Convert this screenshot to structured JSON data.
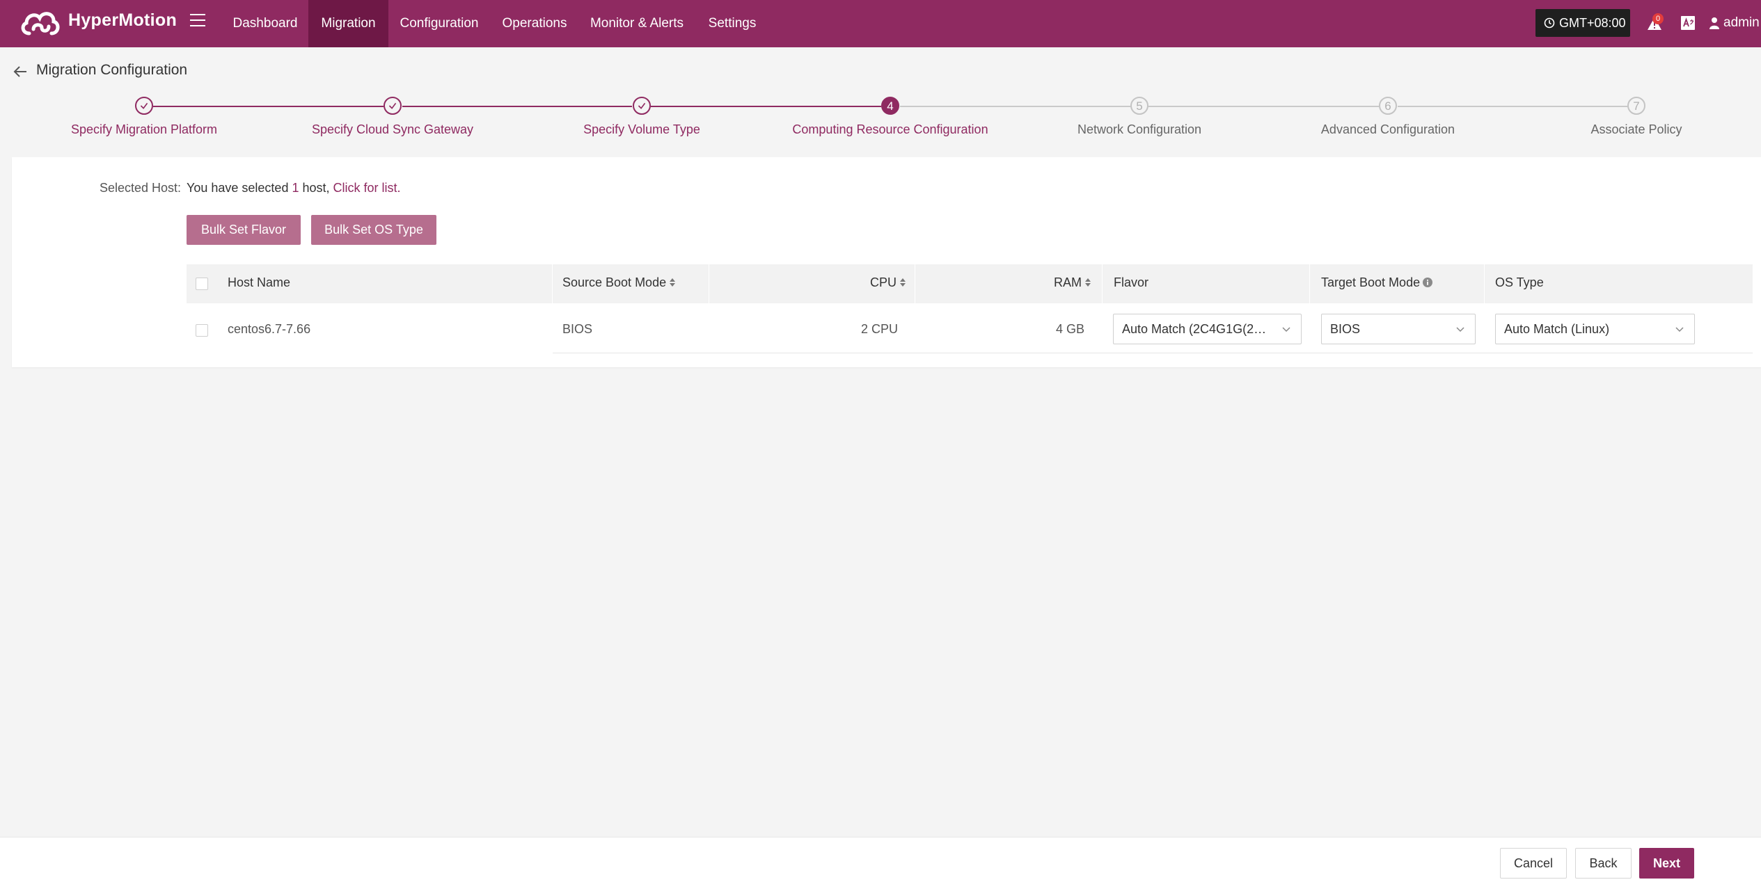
{
  "app": {
    "name": "HyperMotion"
  },
  "nav": {
    "items": [
      "Dashboard",
      "Migration",
      "Configuration",
      "Operations",
      "Monitor & Alerts",
      "Settings"
    ],
    "active": "Migration"
  },
  "header": {
    "timezone": "GMT+08:00",
    "alert_count": "0",
    "user": "admin"
  },
  "page": {
    "title": "Migration Configuration"
  },
  "steps": [
    {
      "num": "1",
      "label": "Specify Migration Platform",
      "state": "done"
    },
    {
      "num": "2",
      "label": "Specify Cloud Sync Gateway",
      "state": "done"
    },
    {
      "num": "3",
      "label": "Specify Volume Type",
      "state": "done"
    },
    {
      "num": "4",
      "label": "Computing Resource Configuration",
      "state": "current"
    },
    {
      "num": "5",
      "label": "Network Configuration",
      "state": "todo"
    },
    {
      "num": "6",
      "label": "Advanced Configuration",
      "state": "todo"
    },
    {
      "num": "7",
      "label": "Associate Policy",
      "state": "todo"
    }
  ],
  "selection": {
    "label": "Selected Host:",
    "prefix": "You have selected ",
    "count": "1",
    "middle": " host, ",
    "link": "Click for list."
  },
  "buttons": {
    "bulk_flavor": "Bulk Set Flavor",
    "bulk_os": "Bulk Set OS Type"
  },
  "table": {
    "columns": {
      "host_name": "Host Name",
      "source_boot_mode": "Source Boot Mode",
      "cpu": "CPU",
      "ram": "RAM",
      "flavor": "Flavor",
      "target_boot_mode": "Target Boot Mode",
      "os_type": "OS Type"
    },
    "rows": [
      {
        "host_name": "centos6.7-7.66",
        "source_boot_mode": "BIOS",
        "cpu": "2 CPU",
        "ram": "4 GB",
        "flavor": "Auto Match (2C4G1G(2C…",
        "target_boot_mode": "BIOS",
        "os_type": "Auto Match (Linux)"
      }
    ]
  },
  "footer": {
    "cancel": "Cancel",
    "back": "Back",
    "next": "Next"
  },
  "colors": {
    "brand": "#8f2a61",
    "brand_dark": "#6e1846",
    "bulk_button": "#b66e8e",
    "timezone_bg": "#1f1f1f",
    "alert_badge": "#e23c3c"
  }
}
